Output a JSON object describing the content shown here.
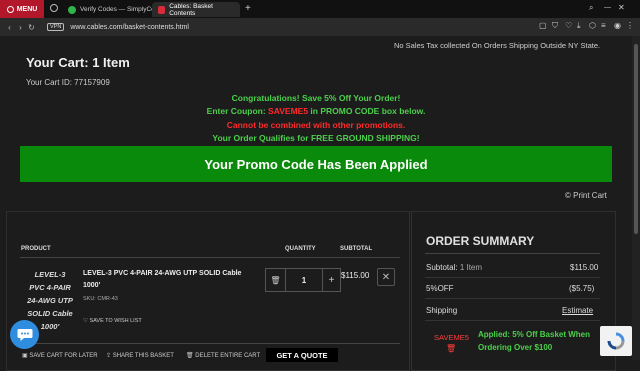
{
  "browser": {
    "menu_label": "MENU",
    "tabs": [
      {
        "label": "Verify Codes — SimplyCo",
        "active": false
      },
      {
        "label": "Cables: Basket Contents",
        "active": true
      }
    ],
    "add_tab": "+",
    "url": "www.cables.com/basket-contents.html",
    "vpn_label": "VPN"
  },
  "page": {
    "tax_note": "No Sales Tax collected On Orders Shipping Outside NY State.",
    "cart_title": "Your Cart: 1 Item",
    "cart_id": "Your Cart ID: 77157909",
    "promo": {
      "line1": "Congratulations! Save 5% Off Your Order!",
      "line2_pre": "Enter Coupon: ",
      "line2_code": "SAVEME5",
      "line2_post": " in PROMO CODE box below.",
      "line3": "Cannot be combined with other promotions.",
      "line4": "Your Order Qualifies for FREE GROUND SHIPPING!",
      "banner": "Your Promo Code Has Been Applied"
    },
    "print_cart": "© Print Cart",
    "table": {
      "headers": {
        "product": "PRODUCT",
        "quantity": "QUANTITY",
        "subtotal": "SUBTOTAL"
      },
      "item": {
        "image_alt_lines": [
          "LEVEL-3",
          "PVC 4-PAIR",
          "24-AWG UTP",
          "SOLID Cable",
          "1000'"
        ],
        "name_line1": "LEVEL-3 PVC 4-PAIR 24-AWG UTP SOLID Cable",
        "name_line2": "1000'",
        "sku": "SKU: CMR-43",
        "save_wishlist": "SAVE TO WISH LIST",
        "quantity": "1",
        "minus": "🗑",
        "plus": "+",
        "subtotal": "$115.00",
        "remove": "✕"
      }
    },
    "footer_actions": {
      "save_later": "SAVE CART FOR LATER",
      "share": "SHARE THIS BASKET",
      "delete": "DELETE ENTIRE CART",
      "quote": "GET A QUOTE"
    },
    "summary": {
      "title": "ORDER SUMMARY",
      "subtotal_label": "Subtotal:",
      "subtotal_items": "1 Item",
      "subtotal_value": "$115.00",
      "discount_label": "5%OFF",
      "discount_value": "($5.75)",
      "shipping_label": "Shipping",
      "shipping_value": "Estimate",
      "coupon_code": "SAVEME5",
      "coupon_applied_line1": "Applied: 5% Off Basket When",
      "coupon_applied_line2": "Ordering Over $100"
    }
  },
  "colors": {
    "menu_red": "#b3172a",
    "promo_green": "#4bd04b",
    "promo_red": "#ff2a2a",
    "banner_green": "#0a8a0a",
    "chat_blue": "#2f8de0"
  }
}
